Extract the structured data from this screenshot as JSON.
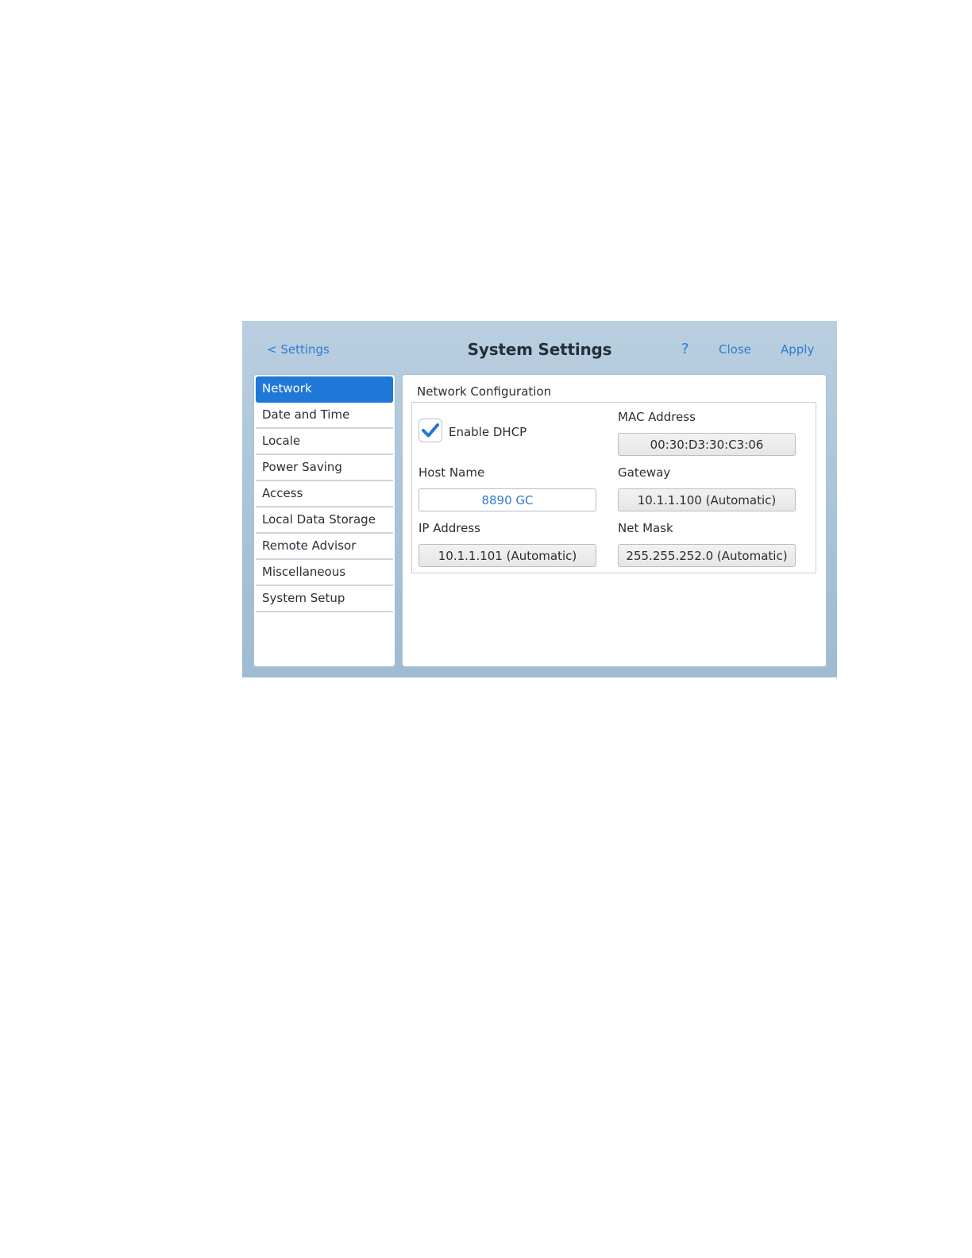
{
  "header": {
    "back_label": "< Settings",
    "title": "System Settings",
    "help_label": "?",
    "close_label": "Close",
    "apply_label": "Apply"
  },
  "sidebar": {
    "items": [
      {
        "label": "Network",
        "selected": true
      },
      {
        "label": "Date and Time",
        "selected": false
      },
      {
        "label": "Locale",
        "selected": false
      },
      {
        "label": "Power Saving",
        "selected": false
      },
      {
        "label": "Access",
        "selected": false
      },
      {
        "label": "Local Data Storage",
        "selected": false
      },
      {
        "label": "Remote Advisor",
        "selected": false
      },
      {
        "label": "Miscellaneous",
        "selected": false
      },
      {
        "label": "System Setup",
        "selected": false
      }
    ]
  },
  "network": {
    "section_title": "Network Configuration",
    "dhcp": {
      "label": "Enable DHCP",
      "checked": true
    },
    "host_name": {
      "label": "Host Name",
      "value": "8890 GC"
    },
    "ip_address": {
      "label": "IP Address",
      "value": "10.1.1.101 (Automatic)"
    },
    "mac_address": {
      "label": "MAC Address",
      "value": "00:30:D3:30:C3:06"
    },
    "gateway": {
      "label": "Gateway",
      "value": "10.1.1.100 (Automatic)"
    },
    "net_mask": {
      "label": "Net Mask",
      "value": "255.255.252.0 (Automatic)"
    }
  },
  "colors": {
    "accent": "#1f78d8",
    "link": "#2f7bd0",
    "background": "#a9c3d8"
  },
  "icons": {
    "checkbox": "checkmark-icon"
  }
}
